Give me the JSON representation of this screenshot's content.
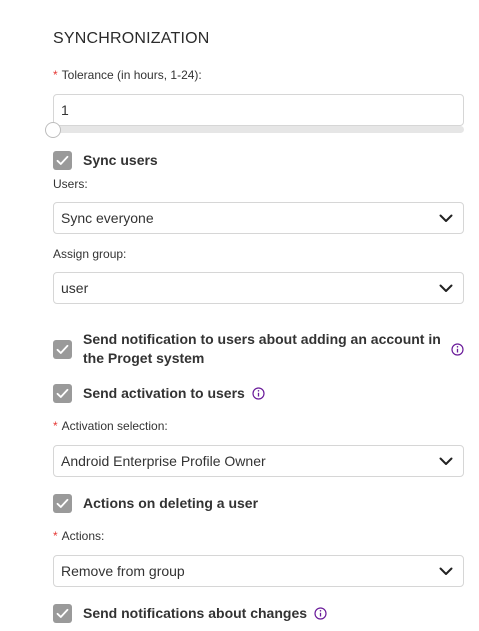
{
  "section": {
    "title": "SYNCHRONIZATION"
  },
  "tolerance": {
    "required_mark": "*",
    "label": "Tolerance (in hours, 1-24):",
    "value": "1",
    "slider_value": 1,
    "slider_min": 1,
    "slider_max": 24
  },
  "sync_users": {
    "label": "Sync users",
    "checked": true
  },
  "users": {
    "label": "Users:",
    "selected": "Sync everyone"
  },
  "assign_group": {
    "label": "Assign group:",
    "selected": "user"
  },
  "send_notification": {
    "label": "Send notification to users about adding an account in the Proget system",
    "checked": true,
    "has_info": true
  },
  "send_activation": {
    "label": "Send activation to users",
    "checked": true,
    "has_info": true
  },
  "activation_selection": {
    "required_mark": "*",
    "label": "Activation selection:",
    "selected": "Android Enterprise Profile Owner"
  },
  "actions_on_delete": {
    "label": "Actions on deleting a user",
    "checked": true
  },
  "actions": {
    "required_mark": "*",
    "label": "Actions:",
    "selected": "Remove from group"
  },
  "send_changes": {
    "label": "Send notifications about changes",
    "checked": true,
    "has_info": true
  },
  "colors": {
    "checkbox": "#9a9a9a",
    "required": "#e53935",
    "info_icon": "#6a1b9a",
    "border": "#d6d6d6"
  }
}
